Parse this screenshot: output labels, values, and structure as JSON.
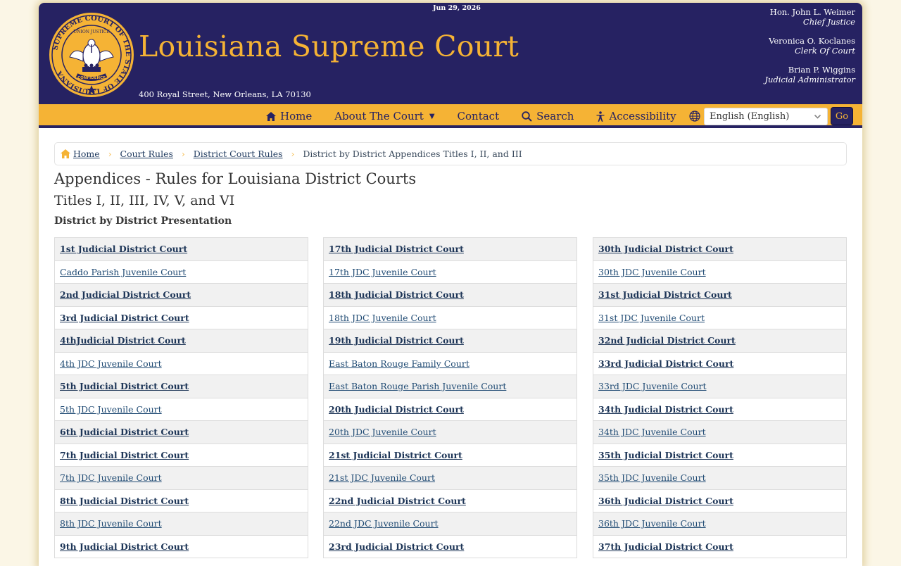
{
  "header": {
    "date": "Jun 29, 2026",
    "title": "Louisiana Supreme Court",
    "address": "400 Royal Street, New Orleans, LA 70130",
    "seal_text": "SUPREME COURT OF THE STATE OF LOUISIANA",
    "seal_motto_top": "UNION JUSTICE",
    "seal_motto_bottom": "CONFIDENCE",
    "officials": [
      {
        "name": "Hon. John L. Weimer",
        "title": "Chief Justice"
      },
      {
        "name": "Veronica O. Koclanes",
        "title": "Clerk Of Court"
      },
      {
        "name": "Brian P. Wiggins",
        "title": "Judicial Administrator"
      }
    ]
  },
  "nav": {
    "items": [
      {
        "label": "Home",
        "icon": "home-icon"
      },
      {
        "label": "About The Court",
        "icon": "",
        "dropdown": true
      },
      {
        "label": "Contact",
        "icon": ""
      },
      {
        "label": "Search",
        "icon": "search-icon"
      },
      {
        "label": "Accessibility",
        "icon": "accessibility-icon"
      }
    ],
    "language_selected": "English (English)",
    "go_label": "Go"
  },
  "breadcrumb": {
    "home": "Home",
    "court_rules": "Court Rules",
    "district_rules": "District Court Rules",
    "current": "District by District Appendices Titles I, II, and III"
  },
  "page": {
    "title": "Appendices - Rules for Louisiana District Courts",
    "subtitle": "Titles I, II, III, IV, V, and VI",
    "section": "District by District Presentation"
  },
  "columns": [
    [
      {
        "label": "1st Judicial District Court",
        "main": true
      },
      {
        "label": "Caddo Parish Juvenile Court",
        "main": false
      },
      {
        "label": "2nd Judicial District Court",
        "main": true
      },
      {
        "label": "3rd Judicial District Court",
        "main": true
      },
      {
        "label": "4thJudicial District Court",
        "main": true
      },
      {
        "label": "4th JDC Juvenile Court",
        "main": false
      },
      {
        "label": "5th Judicial District Court",
        "main": true
      },
      {
        "label": "5th JDC Juvenile Court",
        "main": false
      },
      {
        "label": "6th Judicial District Court",
        "main": true
      },
      {
        "label": "7th Judicial District Court",
        "main": true
      },
      {
        "label": "7th JDC Juvenile Court",
        "main": false
      },
      {
        "label": "8th Judicial District Court",
        "main": true
      },
      {
        "label": "8th JDC Juvenile Court",
        "main": false
      },
      {
        "label": "9th Judicial District Court",
        "main": true
      }
    ],
    [
      {
        "label": "17th Judicial District Court",
        "main": true
      },
      {
        "label": "17th JDC Juvenile Court",
        "main": false
      },
      {
        "label": "18th Judicial District Court",
        "main": true
      },
      {
        "label": "18th JDC Juvenile Court",
        "main": false
      },
      {
        "label": "19th Judicial District Court",
        "main": true
      },
      {
        "label": "East Baton Rouge Family Court",
        "main": false
      },
      {
        "label": "East Baton Rouge Parish Juvenile Court",
        "main": false
      },
      {
        "label": "20th Judicial District Court",
        "main": true
      },
      {
        "label": "20th JDC Juvenile Court",
        "main": false
      },
      {
        "label": "21st Judicial District Court",
        "main": true
      },
      {
        "label": "21st JDC Juvenile Court",
        "main": false
      },
      {
        "label": "22nd Judicial District Court",
        "main": true
      },
      {
        "label": "22nd JDC Juvenile Court",
        "main": false
      },
      {
        "label": "23rd Judicial District Court",
        "main": true
      }
    ],
    [
      {
        "label": "30th Judicial District Court",
        "main": true
      },
      {
        "label": "30th JDC Juvenile Court",
        "main": false
      },
      {
        "label": "31st Judicial District Court",
        "main": true
      },
      {
        "label": "31st JDC Juvenile Court",
        "main": false
      },
      {
        "label": "32nd Judicial District Court",
        "main": true
      },
      {
        "label": "33rd Judicial District Court",
        "main": true
      },
      {
        "label": "33rd JDC Juvenile Court",
        "main": false
      },
      {
        "label": "34th Judicial District Court",
        "main": true
      },
      {
        "label": "34th JDC Juvenile Court",
        "main": false
      },
      {
        "label": "35th Judicial District Court",
        "main": true
      },
      {
        "label": "35th JDC Juvenile Court",
        "main": false
      },
      {
        "label": "36th Judicial District Court",
        "main": true
      },
      {
        "label": "36th JDC Juvenile Court",
        "main": false
      },
      {
        "label": "37th Judicial District Court",
        "main": true
      }
    ]
  ],
  "colors": {
    "navy": "#262262",
    "gold": "#f5b335"
  }
}
